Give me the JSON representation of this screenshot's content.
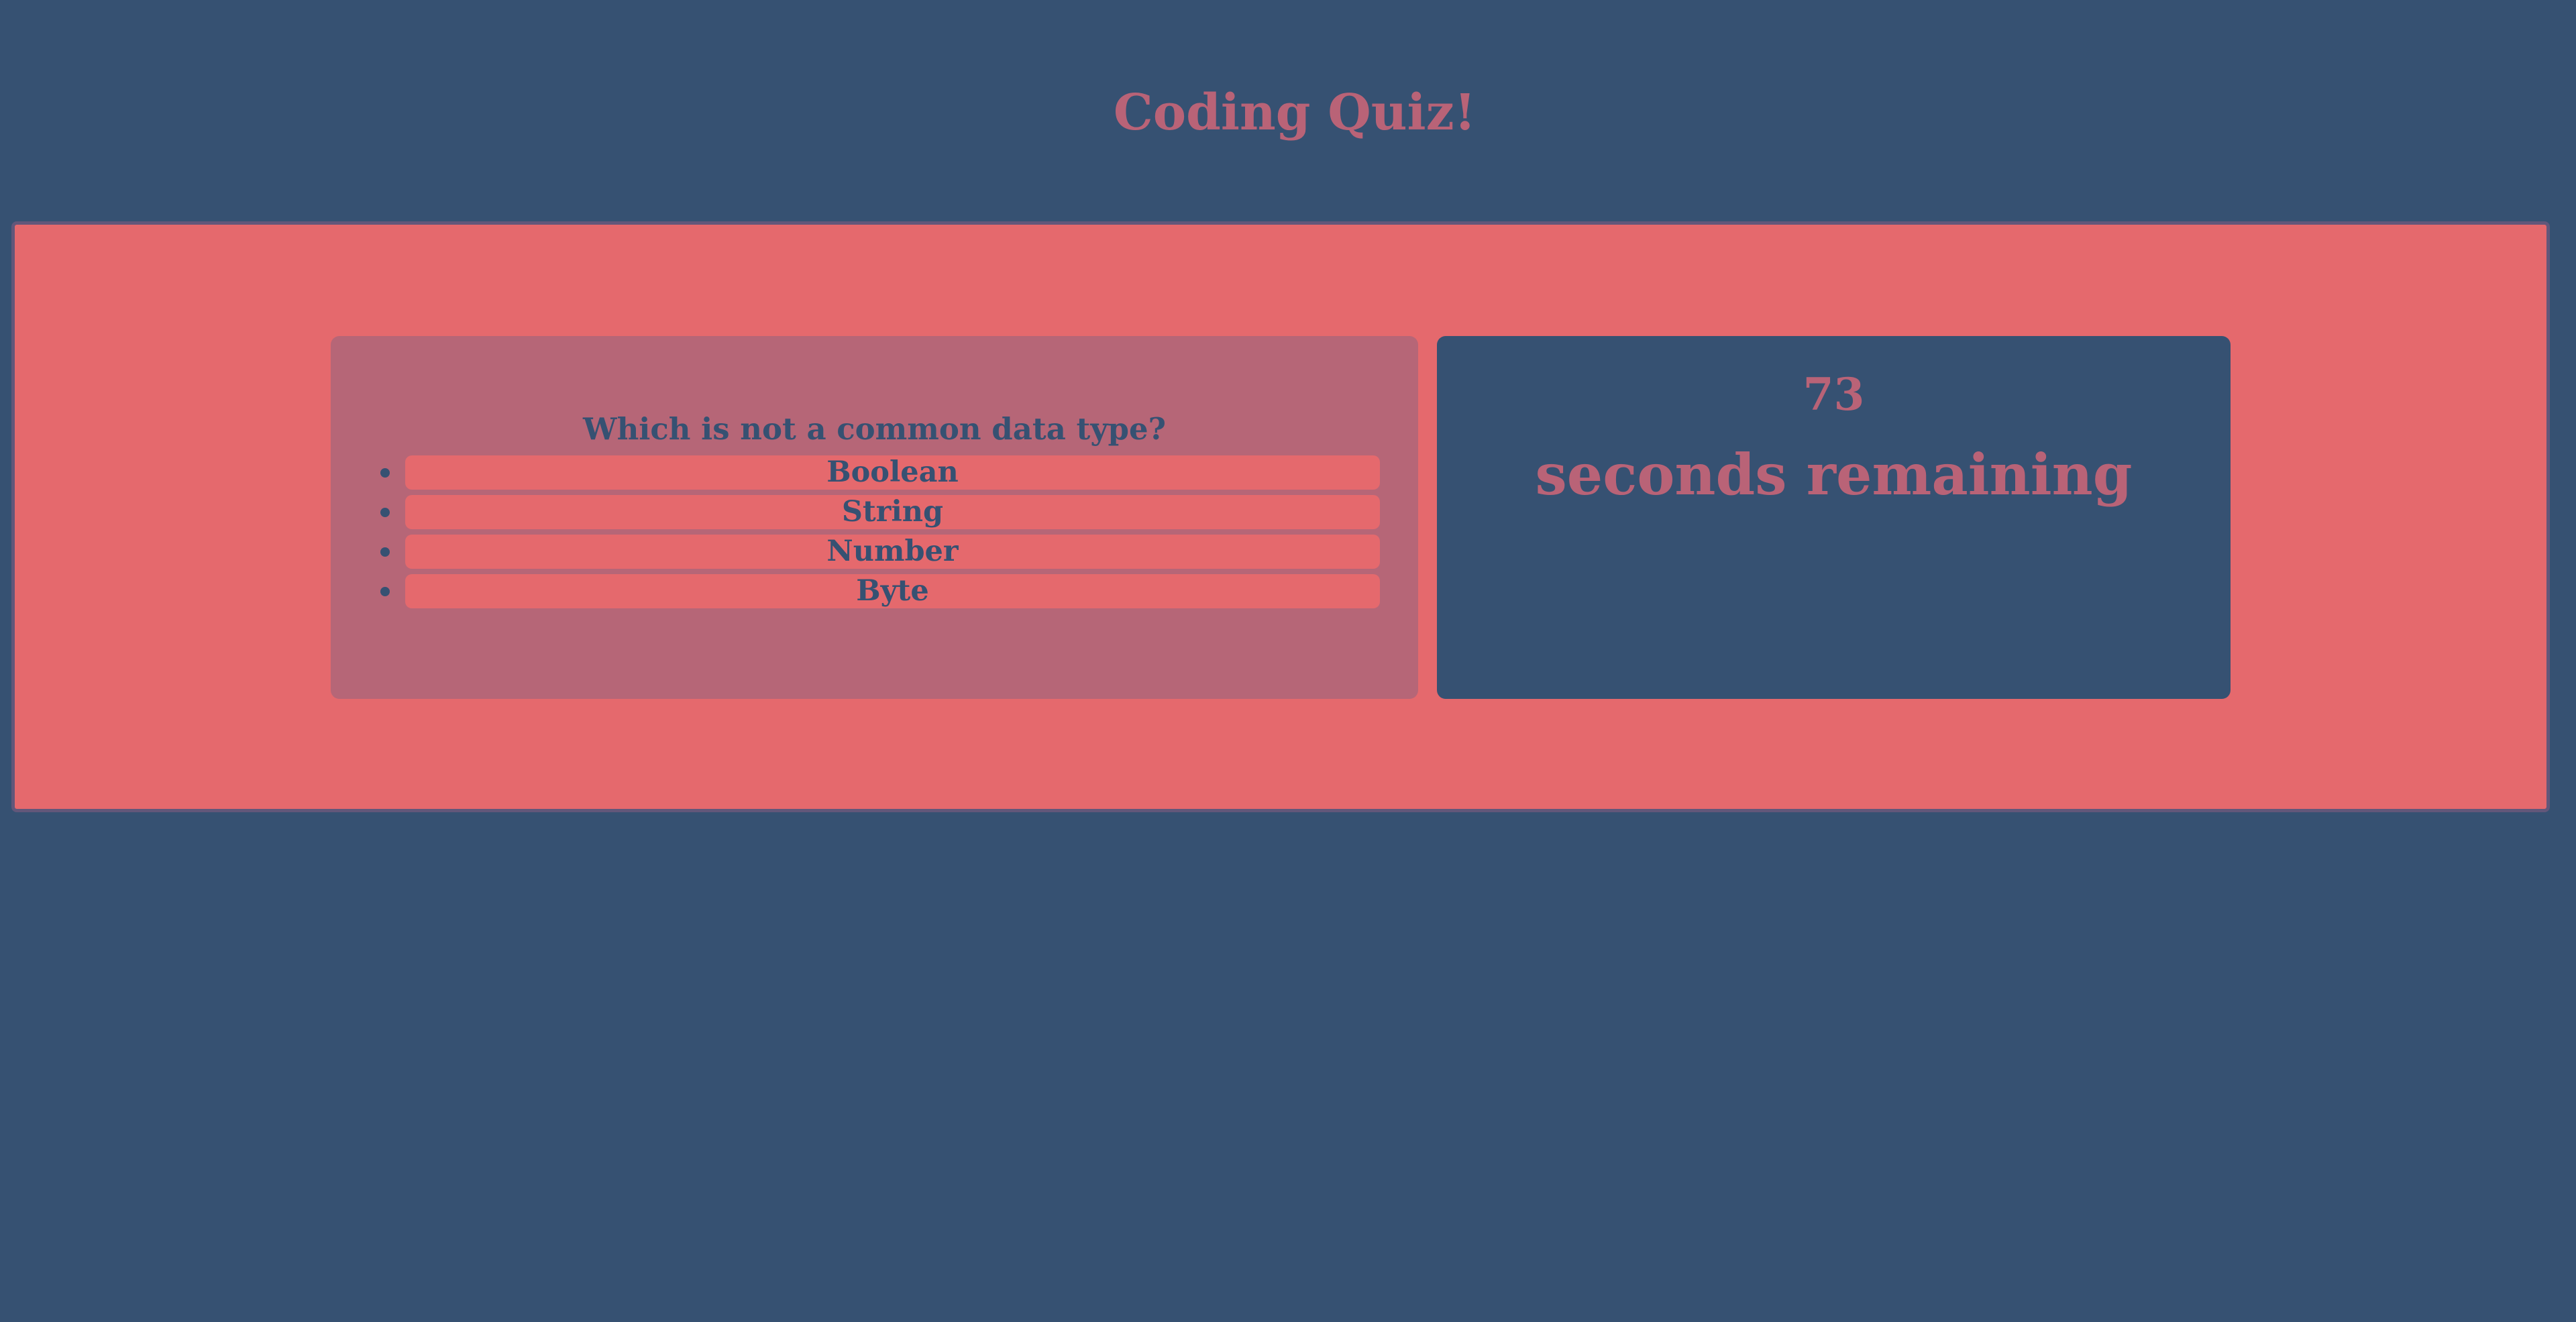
{
  "header": {
    "title": "Coding Quiz!"
  },
  "quiz": {
    "question": "Which is not a common data type?",
    "answers": [
      {
        "label": "Boolean"
      },
      {
        "label": "String"
      },
      {
        "label": "Number"
      },
      {
        "label": "Byte"
      }
    ]
  },
  "timer": {
    "seconds": "73",
    "label": "seconds remaining"
  },
  "colors": {
    "background": "#365172",
    "panel": "#e5696d",
    "panel_border": "#62577a",
    "question_card": "#b66677",
    "accent_text": "#b96377",
    "dark_text": "#365172"
  }
}
